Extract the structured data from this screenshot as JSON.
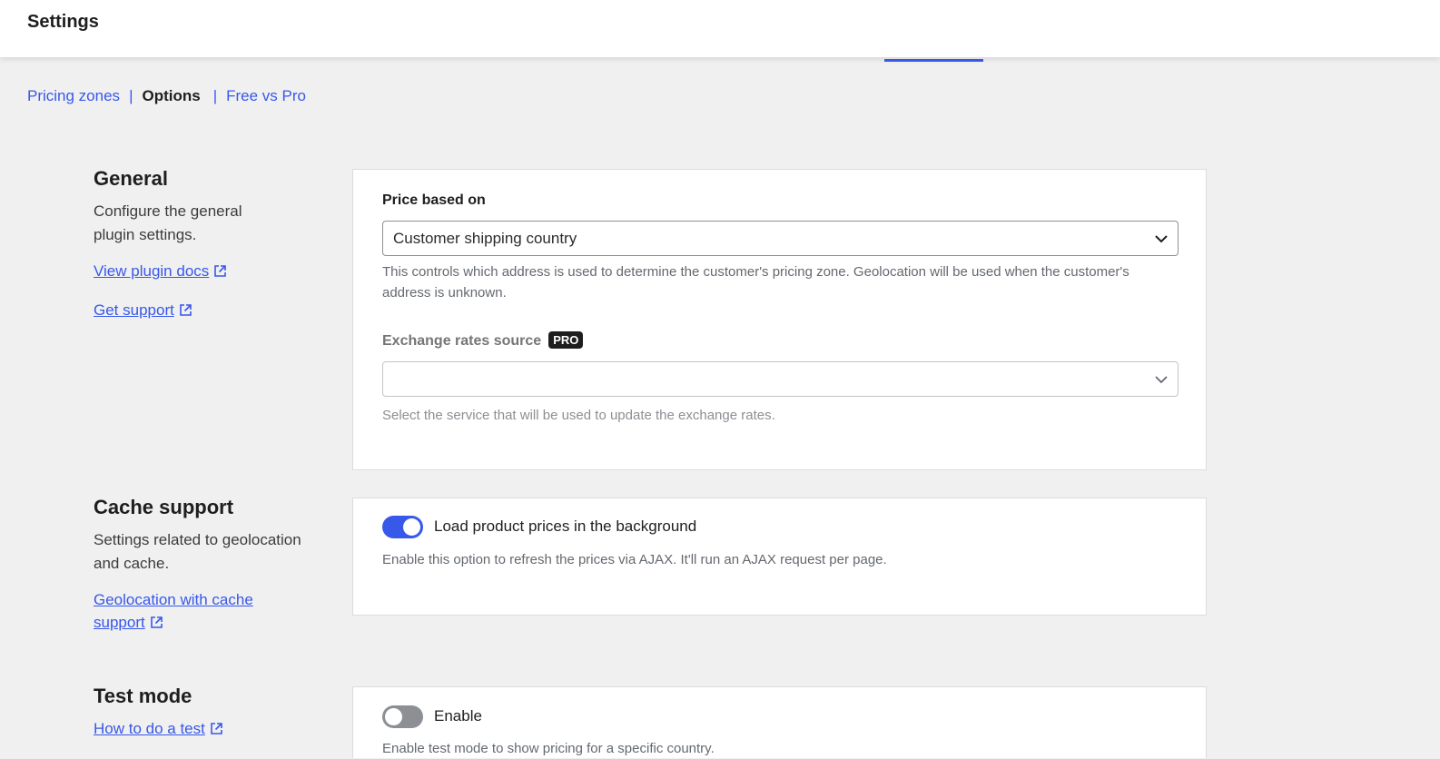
{
  "header": {
    "title": "Settings"
  },
  "subnav": {
    "items": [
      {
        "label": "Pricing zones"
      },
      {
        "label": "Options"
      },
      {
        "label": "Free vs Pro"
      }
    ],
    "separator": "|"
  },
  "general": {
    "title": "General",
    "description": "Configure the general plugin settings.",
    "links": [
      {
        "label": "View plugin docs",
        "icon": "external-link-icon"
      },
      {
        "label": "Get support",
        "icon": "external-link-icon"
      }
    ],
    "price_based_on": {
      "label": "Price based on",
      "value": "Customer shipping country",
      "help": "This controls which address is used to determine the customer's pricing zone. Geolocation will be used when the customer's address is unknown."
    },
    "exchange_rates": {
      "label": "Exchange rates source",
      "badge": "PRO",
      "value": "",
      "help": "Select the service that will be used to update the exchange rates."
    }
  },
  "cache": {
    "title": "Cache support",
    "description": "Settings related to geolocation and cache.",
    "link": {
      "label_line1": "Geolocation with cache",
      "label_line2": "support",
      "icon": "external-link-icon"
    },
    "toggle": {
      "label": "Load product prices in the background",
      "enabled": true,
      "help": "Enable this option to refresh the prices via AJAX. It'll run an AJAX request per page."
    }
  },
  "test_mode": {
    "title": "Test mode",
    "link": {
      "label": "How to do a test",
      "icon": "external-link-icon"
    },
    "toggle": {
      "label": "Enable",
      "enabled": false,
      "help": "Enable test mode to show pricing for a specific country."
    }
  },
  "colors": {
    "accent": "#3858e9",
    "background": "#f0f0f1",
    "card": "#ffffff",
    "toggle_off": "#8c8f94"
  }
}
